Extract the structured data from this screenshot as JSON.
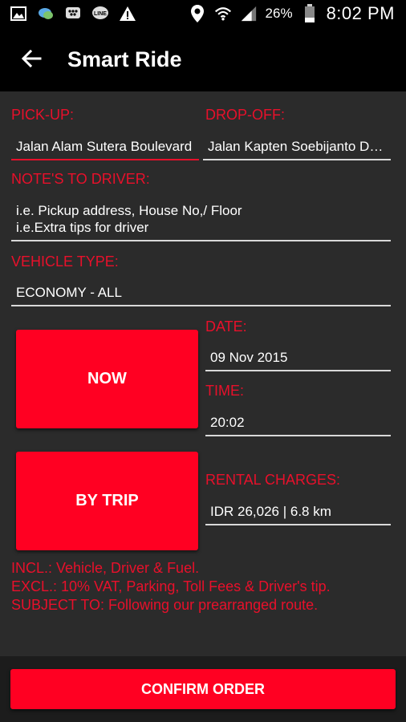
{
  "status_bar": {
    "battery_pct": "26%",
    "time": "8:02 PM",
    "icons": [
      "gallery-icon",
      "chat-icon",
      "bbm-icon",
      "line-icon",
      "warning-icon",
      "location-icon",
      "wifi-icon",
      "signal-icon",
      "battery-icon"
    ]
  },
  "app_bar": {
    "title": "Smart Ride",
    "back_icon": "arrow-left-icon"
  },
  "form": {
    "pickup_label": "PICK-UP:",
    "pickup_value": "Jalan Alam Sutera Boulevard",
    "dropoff_label": "DROP-OFF:",
    "dropoff_value": "Jalan Kapten Soebijanto Djojohadikusumo",
    "notes_label": "NOTE'S TO DRIVER:",
    "notes_line1": "i.e. Pickup address, House No,/ Floor",
    "notes_line2": "i.e.Extra tips for driver",
    "vehicle_label": "VEHICLE TYPE:",
    "vehicle_value": "ECONOMY - ALL",
    "now_button": "NOW",
    "date_label": "DATE:",
    "date_value": "09 Nov 2015",
    "time_label": "TIME:",
    "time_value": "20:02",
    "bytrip_button": "BY TRIP",
    "rental_label": "RENTAL CHARGES:",
    "rental_value": "IDR 26,026 | 6.8 km"
  },
  "notes": {
    "incl": "INCL.: Vehicle, Driver & Fuel.",
    "excl": "EXCL.: 10% VAT, Parking, Toll Fees & Driver's tip.",
    "subject": "SUBJECT TO: Following our prearranged route."
  },
  "confirm_button": "CONFIRM ORDER",
  "colors": {
    "accent": "#ff0022",
    "label_red": "#e8102b",
    "background": "#2b2b2b",
    "bar": "#000000"
  }
}
